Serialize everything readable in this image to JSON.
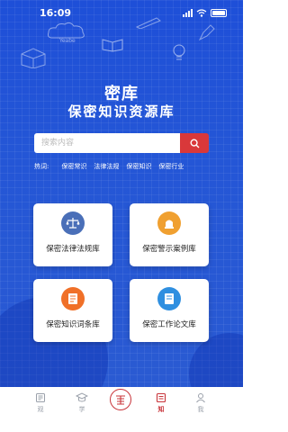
{
  "status_bar": {
    "time": "16:09"
  },
  "header": {
    "title": "密库",
    "subtitle": "保密知识资源库"
  },
  "search": {
    "placeholder": "搜索内容"
  },
  "hot": {
    "label": "热词:",
    "items": [
      "保密常识",
      "法律法规",
      "保密知识",
      "保密行业"
    ]
  },
  "doodle": {
    "text": "Yeabe"
  },
  "cards": [
    {
      "label": "保密法律法规库",
      "icon": "scales-icon",
      "color": "#4a6fb8"
    },
    {
      "label": "保密警示案例库",
      "icon": "alarm-bell-icon",
      "color": "#f0a030"
    },
    {
      "label": "保密知识词条库",
      "icon": "document-icon",
      "color": "#f07028"
    },
    {
      "label": "保密工作论文库",
      "icon": "book-icon",
      "color": "#2f8fe0"
    }
  ],
  "tabbar": {
    "items": [
      {
        "label": "观",
        "icon": "news-icon"
      },
      {
        "label": "学",
        "icon": "graduation-cap-icon"
      },
      {
        "label": "知",
        "icon": "books-icon",
        "active": true
      },
      {
        "label": "我",
        "icon": "user-icon"
      }
    ],
    "center_logo": "seal-logo-icon"
  },
  "colors": {
    "primary": "#2456d6",
    "accent": "#d9383a",
    "active_tab": "#c8343a",
    "muted_tab": "#9aa0aa"
  }
}
